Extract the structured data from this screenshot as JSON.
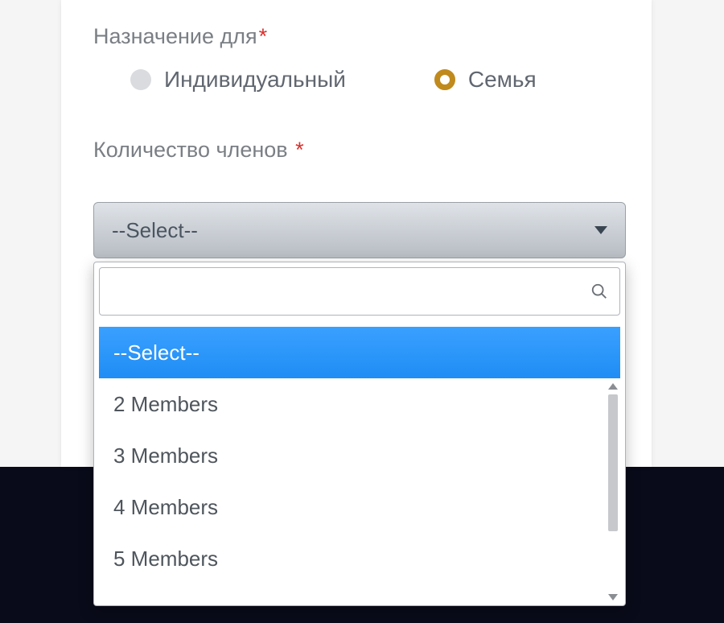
{
  "purpose": {
    "label": "Назначение для",
    "required": "*",
    "options": {
      "individual": "Индивидуальный",
      "family": "Семья"
    },
    "selected": "family"
  },
  "members": {
    "label": "Количество членов ",
    "required": "*"
  },
  "dropdown": {
    "selected_display": "--Select--",
    "search_value": "",
    "options": {
      "placeholder": "--Select--",
      "o2": "2 Members",
      "o3": "3 Members",
      "o4": "4 Members",
      "o5": "5 Members"
    }
  }
}
